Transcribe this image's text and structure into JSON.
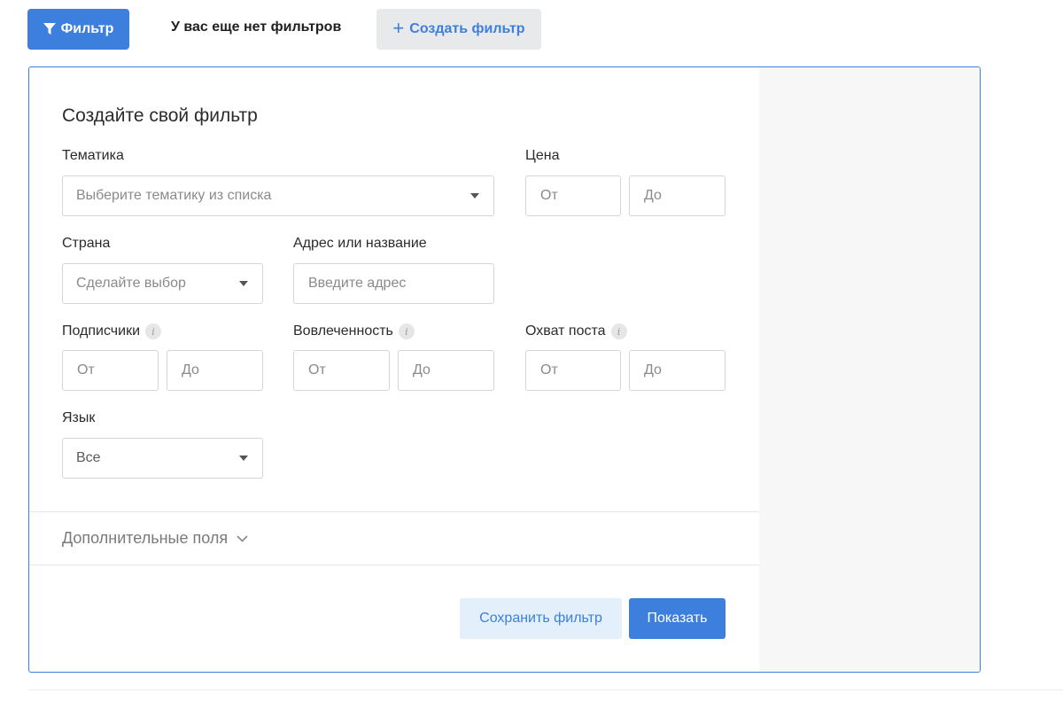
{
  "topbar": {
    "filter_button": "Фильтр",
    "no_filters_text": "У вас еще нет фильтров",
    "create_filter_button": "Создать фильтр"
  },
  "panel": {
    "title": "Создайте свой фильтр",
    "topic": {
      "label": "Тематика",
      "placeholder": "Выберите тематику из списка"
    },
    "price": {
      "label": "Цена",
      "from": "От",
      "to": "До"
    },
    "country": {
      "label": "Страна",
      "placeholder": "Сделайте выбор"
    },
    "address": {
      "label": "Адрес или название",
      "placeholder": "Введите адрес"
    },
    "subscribers": {
      "label": "Подписчики",
      "from": "От",
      "to": "До"
    },
    "engagement": {
      "label": "Вовлеченность",
      "from": "От",
      "to": "До"
    },
    "reach": {
      "label": "Охват поста",
      "from": "От",
      "to": "До"
    },
    "language": {
      "label": "Язык",
      "value": "Все"
    },
    "extra_fields": "Дополнительные поля",
    "save_button": "Сохранить фильтр",
    "show_button": "Показать"
  },
  "colors": {
    "accent": "#3d7fdc",
    "accent_light": "#e3effb",
    "border": "#d5d5d5",
    "side_panel": "#f7f7f7"
  },
  "icons": {
    "filter": "funnel-icon",
    "create": "plus-icon",
    "info": "info-icon",
    "caret": "caret-down-icon",
    "expand": "chevron-down-icon"
  }
}
